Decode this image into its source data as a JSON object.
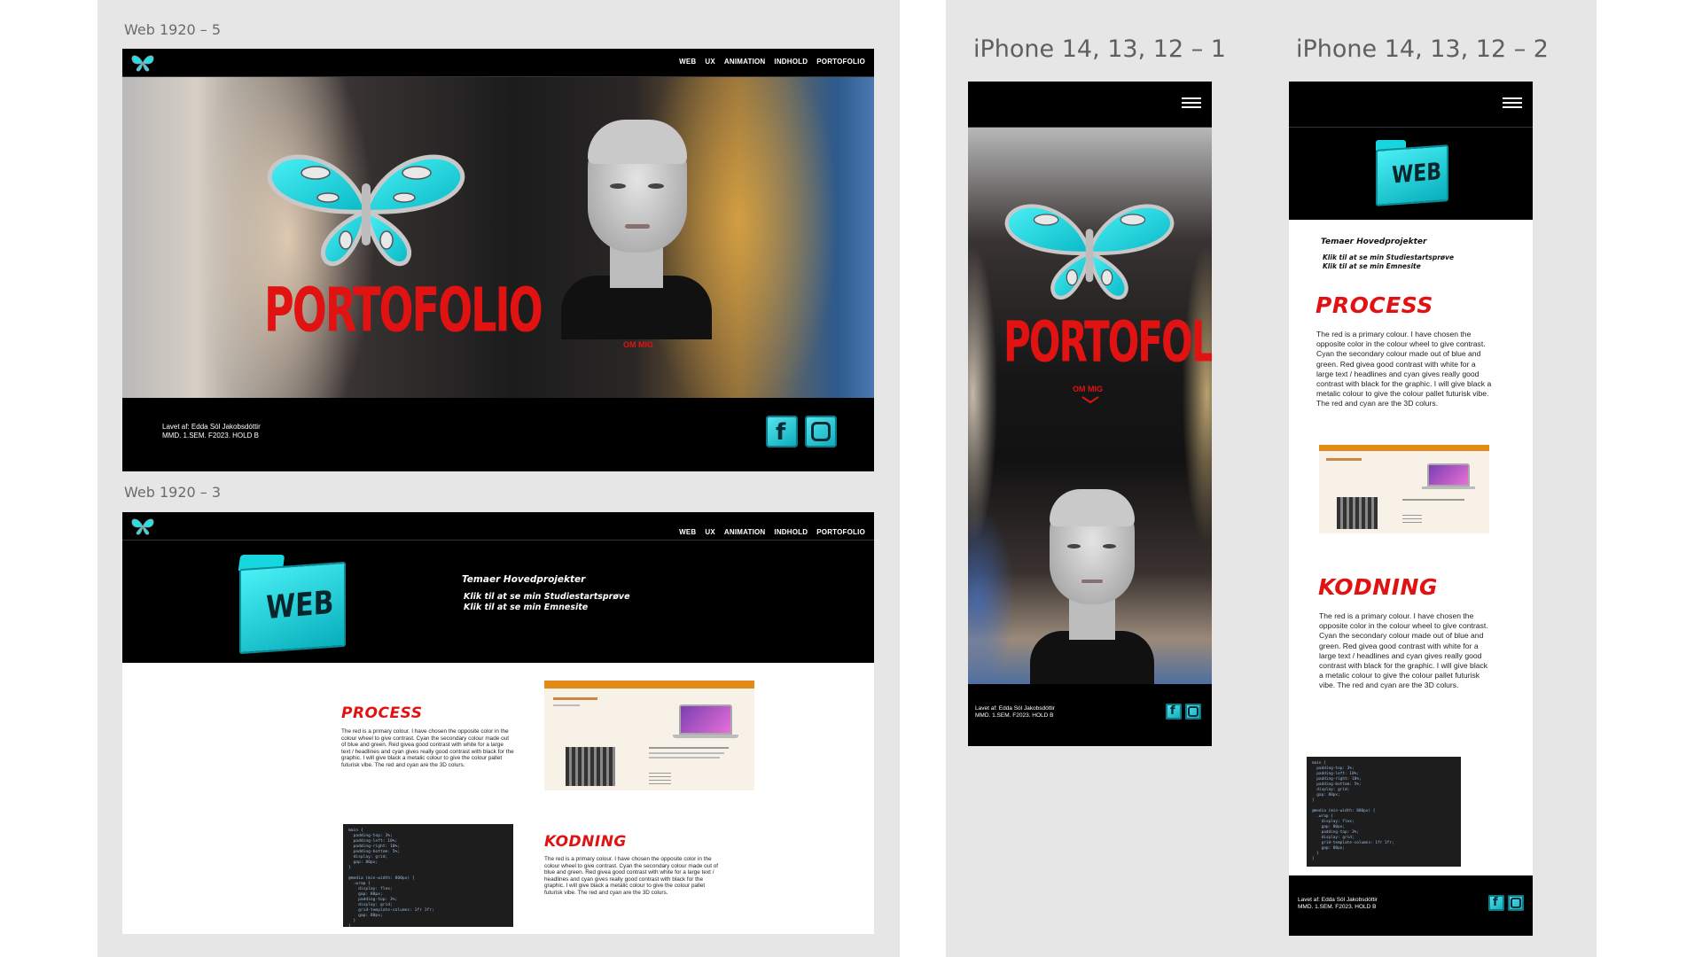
{
  "canvas": {
    "frame_labels": {
      "web5": "Web 1920 – 5",
      "web3": "Web 1920 – 3",
      "iphone1": "iPhone 14, 13, 12 – 1",
      "iphone2": "iPhone 14, 13, 12 – 2"
    }
  },
  "nav": {
    "items": [
      "WEB",
      "UX",
      "ANIMATION",
      "INDHOLD",
      "PORTOFOLIO"
    ]
  },
  "hero": {
    "title": "PORTOFOLIO",
    "om_mig": "OM MIG"
  },
  "footer": {
    "credit_line1": "Lavet af: Edda Sól Jakobsdóttir",
    "credit_line2": "MMD. 1.SEM. F2023. HOLD B"
  },
  "web_page": {
    "folder_label": "WEB",
    "projects_heading": "Temaer Hovedprojekter",
    "link1": "Klik til at se min Studiestartsprøve",
    "link2": "Klik til at se min Emnesite",
    "process_title": "PROCESS",
    "kodning_title": "KODNING",
    "body": "The red is a primary colour. I have chosen the opposite color in the colour wheel to give contrast. Cyan the secondary colour made out of blue and green. Red givea good contrast with white for a large text / headlines and cyan gives really good contrast with black for the graphic. I will give black a metalic colour to give the colour pallet futurisk vibe. The red and cyan are the 3D colurs."
  },
  "mobile_page": {
    "links1": "Klik til at se min Studiestartsprøve",
    "links2": "Klik til at se min Emnesite"
  },
  "code_snippet": "main {\n  padding-top: 3%;\n  padding-left: 10%;\n  padding-right: 10%;\n  padding-bottom: 5%;\n  display: grid;\n  gap: 80px;\n}\n\n@media (min-width: 800px) {\n  .wrap {\n    display: flex;\n    gap: 80px;\n    padding-top: 3%;\n    display: grid;\n    grid-template-columns: 1fr 1fr;\n    gap: 80px;\n  }\n}",
  "colors": {
    "accent_red": "#e11212",
    "accent_cyan": "#17d6e0",
    "dark": "#000000"
  }
}
